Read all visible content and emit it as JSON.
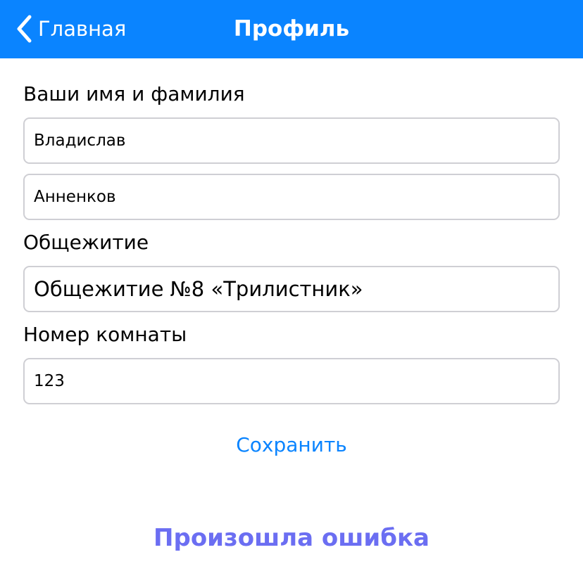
{
  "navbar": {
    "back_label": "Главная",
    "title": "Профиль",
    "color": "#0a84ff"
  },
  "form": {
    "name_label": "Ваши имя и фамилия",
    "first_name": "Владислав",
    "last_name": "Анненков",
    "dorm_label": "Общежитие",
    "dorm_value": "Общежитие №8 «Трилистник»",
    "room_label": "Номер комнаты",
    "room_value": "123",
    "save_label": "Сохранить"
  },
  "error": {
    "message": "Произошла ошибка",
    "color": "#6b6ef2"
  },
  "icons": {
    "back": "chevron-left-icon"
  }
}
